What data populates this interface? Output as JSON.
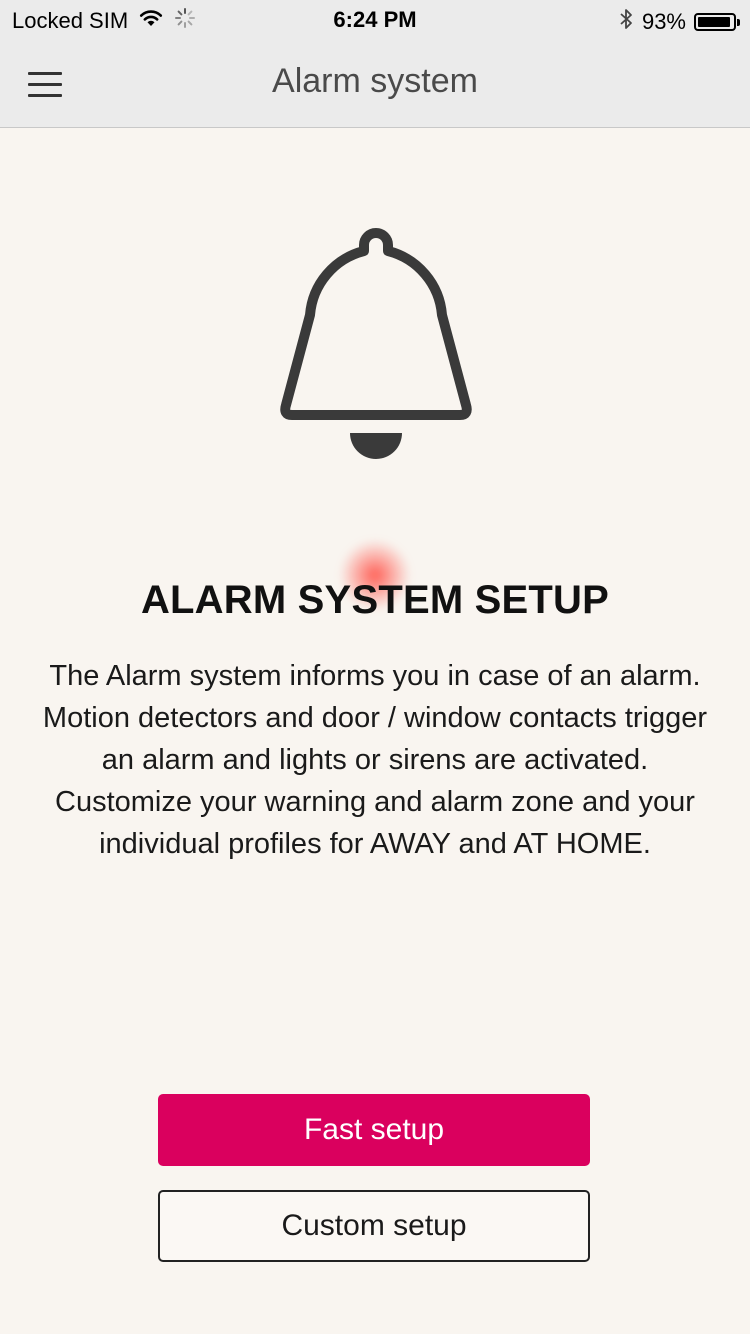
{
  "status_bar": {
    "carrier": "Locked SIM",
    "time": "6:24 PM",
    "battery_percent": "93%",
    "battery_level": 0.93,
    "icons": [
      "wifi-icon",
      "activity-spinner-icon",
      "bluetooth-icon",
      "battery-icon"
    ]
  },
  "nav": {
    "title": "Alarm system",
    "menu_icon": "hamburger-menu-icon"
  },
  "main": {
    "illustration_icon": "bell-icon",
    "heading": "ALARM SYSTEM SETUP",
    "description_lines": [
      "The Alarm system informs you in case of an alarm.",
      "Motion detectors and door / window contacts trigger",
      "an alarm and lights or sirens are activated.",
      "Customize your warning and alarm zone and your",
      "individual profiles for AWAY and AT HOME."
    ]
  },
  "actions": {
    "fast_setup_label": "Fast setup",
    "custom_setup_label": "Custom setup"
  },
  "colors": {
    "accent": "#da005e",
    "background": "#f9f5f0",
    "bar_background": "#ebebeb"
  }
}
